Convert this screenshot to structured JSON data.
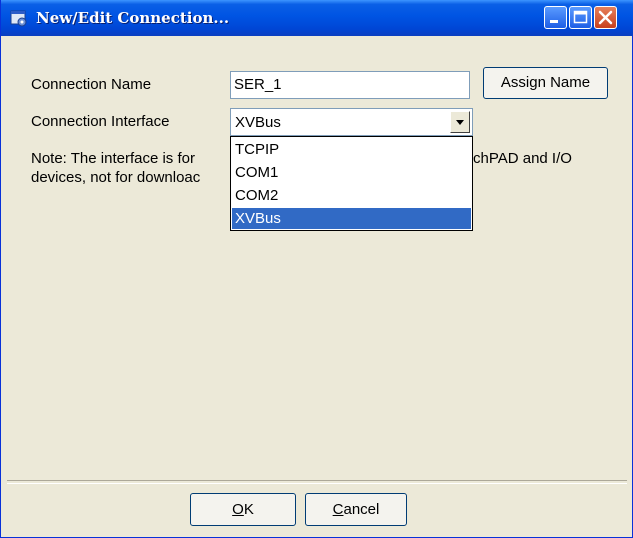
{
  "window": {
    "title": "New/Edit Connection...",
    "icon": "app-icon"
  },
  "titlebar_buttons": {
    "minimize": "minimize-icon",
    "maximize": "maximize-icon",
    "close": "close-icon"
  },
  "form": {
    "connection_name_label": "Connection Name",
    "connection_name_value": "SER_1",
    "assign_name_label": "Assign Name",
    "connection_interface_label": "Connection Interface",
    "connection_interface_value": "XVBus",
    "note_line1_part1": "Note: The interface is for",
    "note_line1_part2": "chPAD and I/O",
    "note_line2": "devices, not for downloac"
  },
  "dropdown": {
    "options": [
      "TCPIP",
      "COM1",
      "COM2",
      "XVBus"
    ],
    "selected": "XVBus"
  },
  "buttons": {
    "ok_accel": "O",
    "ok_rest": "K",
    "cancel_accel": "C",
    "cancel_rest": "ancel"
  },
  "colors": {
    "titlebar": "#0054e3",
    "dialog_bg": "#ece9d8",
    "selection": "#316ac5"
  }
}
